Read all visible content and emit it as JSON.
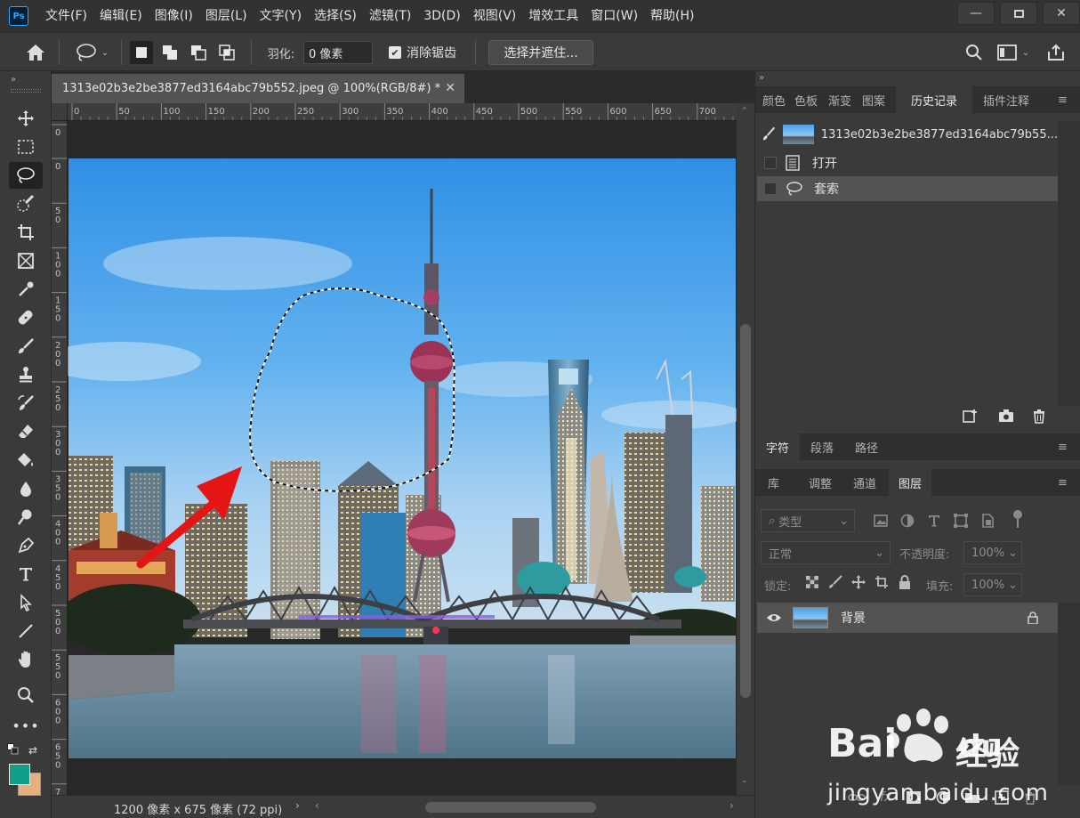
{
  "app": {
    "logo_text": "Ps",
    "menu": [
      "文件(F)",
      "编辑(E)",
      "图像(I)",
      "图层(L)",
      "文字(Y)",
      "选择(S)",
      "滤镜(T)",
      "3D(D)",
      "视图(V)",
      "增效工具",
      "窗口(W)",
      "帮助(H)"
    ]
  },
  "options": {
    "feather_label": "羽化:",
    "feather_value": "0 像素",
    "antialias_label": "消除锯齿",
    "select_mask_label": "选择并遮住..."
  },
  "document": {
    "tab_title": "1313e02b3e2be3877ed3164abc79b552.jpeg @ 100%(RGB/8#) *",
    "status_info": "1200 像素 x 675 像素 (72 ppi)"
  },
  "rulers": {
    "h_labels": [
      "0",
      "50",
      "100",
      "150",
      "200",
      "250",
      "300",
      "350",
      "400",
      "450",
      "500",
      "550",
      "600",
      "650",
      "700"
    ],
    "v_labels": [
      "0",
      "0",
      "50",
      "100",
      "150",
      "200",
      "250",
      "300",
      "350",
      "400",
      "450",
      "500",
      "550",
      "600",
      "650",
      "700"
    ]
  },
  "panels": {
    "top_tabs": [
      "颜色",
      "色板",
      "渐变",
      "图案",
      "历史记录",
      "插件",
      "注释"
    ],
    "history": {
      "snapshot_name": "1313e02b3e2be3877ed3164abc79b55...",
      "steps": [
        "打开",
        "套索"
      ]
    },
    "mid_tabs": [
      "字符",
      "段落",
      "路径"
    ],
    "layer_tabs": [
      "库",
      "调整",
      "通道",
      "图层"
    ],
    "layers": {
      "filter_label": "类型",
      "blend_mode": "正常",
      "opacity_label": "不透明度:",
      "opacity_value": "100%",
      "lock_label": "锁定:",
      "fill_label": "填充:",
      "fill_value": "100%",
      "items": [
        {
          "name": "背景"
        }
      ]
    }
  },
  "watermark": {
    "brand": "Bai",
    "brand_suffix": "du",
    "cn": "经验",
    "url": "jingyan.baidu.com"
  },
  "colors": {
    "foreground": "#10a08a",
    "background": "#e8b080",
    "accent": "#31a8ff",
    "arrow": "#e61515"
  }
}
